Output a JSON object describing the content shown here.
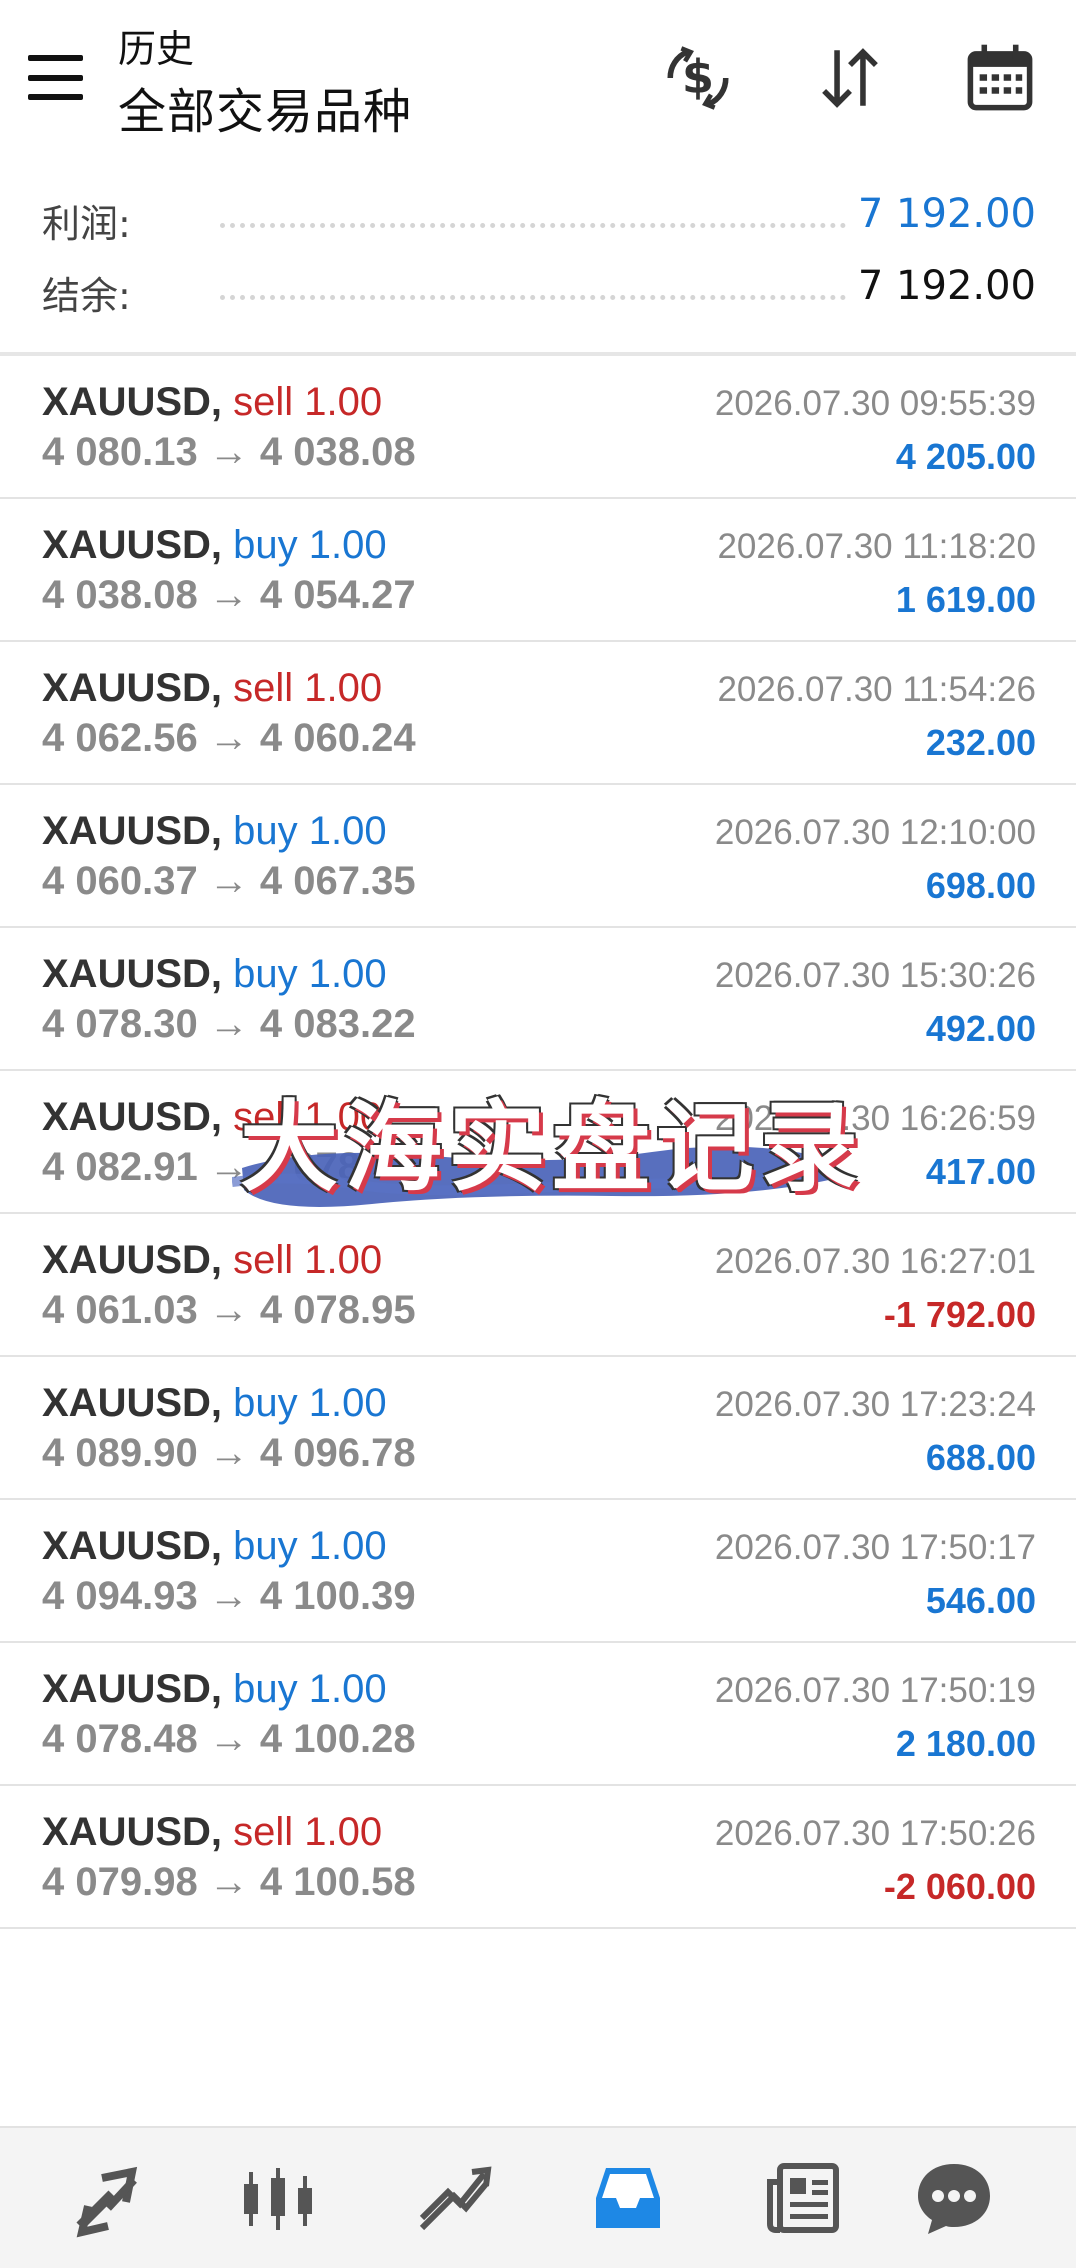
{
  "header": {
    "section": "历史",
    "filter": "全部交易品种",
    "icons": [
      "currency-exchange-icon",
      "sort-icon",
      "calendar-icon"
    ]
  },
  "summary": {
    "profit_label": "利润:",
    "profit_value": "7 192.00",
    "balance_label": "结余:",
    "balance_value": "7 192.00"
  },
  "deals": [
    {
      "symbol": "XAUUSD,",
      "direction": "sell",
      "volume": "sell 1.00",
      "prices": "4 080.13 → 4 038.08",
      "time": "2026.07.30 09:55:39",
      "pnl": "4 205.00",
      "sign": "pos"
    },
    {
      "symbol": "XAUUSD,",
      "direction": "buy",
      "volume": "buy 1.00",
      "prices": "4 038.08 → 4 054.27",
      "time": "2026.07.30 11:18:20",
      "pnl": "1 619.00",
      "sign": "pos"
    },
    {
      "symbol": "XAUUSD,",
      "direction": "sell",
      "volume": "sell 1.00",
      "prices": "4 062.56 → 4 060.24",
      "time": "2026.07.30 11:54:26",
      "pnl": "232.00",
      "sign": "pos"
    },
    {
      "symbol": "XAUUSD,",
      "direction": "buy",
      "volume": "buy 1.00",
      "prices": "4 060.37 → 4 067.35",
      "time": "2026.07.30 12:10:00",
      "pnl": "698.00",
      "sign": "pos"
    },
    {
      "symbol": "XAUUSD,",
      "direction": "buy",
      "volume": "buy 1.00",
      "prices": "4 078.30 → 4 083.22",
      "time": "2026.07.30 15:30:26",
      "pnl": "492.00",
      "sign": "pos"
    },
    {
      "symbol": "XAUUSD,",
      "direction": "sell",
      "volume": "sell 1.00",
      "prices": "4 082.91 → 4 078.74",
      "time": "2026.07.30 16:26:59",
      "pnl": "417.00",
      "sign": "pos"
    },
    {
      "symbol": "XAUUSD,",
      "direction": "sell",
      "volume": "sell 1.00",
      "prices": "4 061.03 → 4 078.95",
      "time": "2026.07.30 16:27:01",
      "pnl": "-1 792.00",
      "sign": "neg"
    },
    {
      "symbol": "XAUUSD,",
      "direction": "buy",
      "volume": "buy 1.00",
      "prices": "4 089.90 → 4 096.78",
      "time": "2026.07.30 17:23:24",
      "pnl": "688.00",
      "sign": "pos"
    },
    {
      "symbol": "XAUUSD,",
      "direction": "buy",
      "volume": "buy 1.00",
      "prices": "4 094.93 → 4 100.39",
      "time": "2026.07.30 17:50:17",
      "pnl": "546.00",
      "sign": "pos"
    },
    {
      "symbol": "XAUUSD,",
      "direction": "buy",
      "volume": "buy 1.00",
      "prices": "4 078.48 → 4 100.28",
      "time": "2026.07.30 17:50:19",
      "pnl": "2 180.00",
      "sign": "pos"
    },
    {
      "symbol": "XAUUSD,",
      "direction": "sell",
      "volume": "sell 1.00",
      "prices": "4 079.98 → 4 100.58",
      "time": "2026.07.30 17:50:26",
      "pnl": "-2 060.00",
      "sign": "neg"
    }
  ],
  "watermark": {
    "text": "大海实盘记录",
    "brush_color": "#4a63b8"
  },
  "bottom_nav": {
    "items": [
      "quotes-icon",
      "chart-icon",
      "trade-icon",
      "history-icon",
      "news-icon",
      "chat-icon"
    ],
    "active": "history-icon",
    "active_color": "#1e88e5"
  }
}
